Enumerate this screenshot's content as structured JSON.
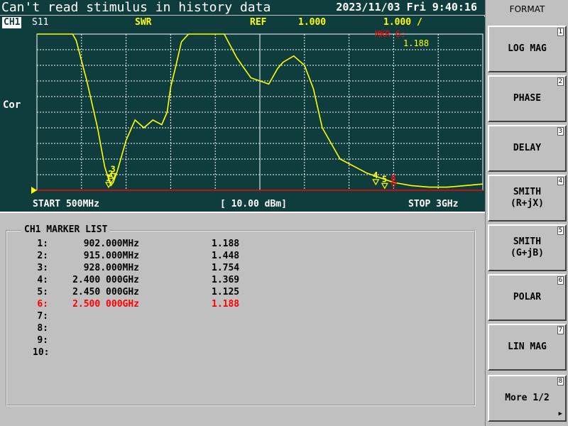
{
  "status": {
    "message": "Can't read stimulus in history data",
    "datetime": "2023/11/03 Fri   9:40:16"
  },
  "trace_header": {
    "channel": "CH1",
    "param": "S11",
    "format": "SWR",
    "ref_label": "REF",
    "ref_value": "1.000",
    "scale": "1.000 /",
    "marker_readout_label": "MKR 6:",
    "marker_readout_value": "1.188"
  },
  "side_label": "Cor",
  "colors": {
    "background": "#0f3d3d",
    "trace": "#ffff00",
    "grid": "#ffffff",
    "ref_line": "#ff0000",
    "active_marker": "#ff0000",
    "panel": "#c0c0c0"
  },
  "stimulus": {
    "start": "START 500MHz",
    "power": "[ 10.00 dBm]",
    "stop": "STOP 3GHz"
  },
  "chart_data": {
    "type": "line",
    "xlabel": "",
    "ylabel": "",
    "xlim": [
      0.5,
      3.0
    ],
    "ylim": [
      1.0,
      11.0
    ],
    "grid": true,
    "x": [
      0.5,
      0.7,
      0.72,
      0.78,
      0.84,
      0.88,
      0.9,
      0.915,
      0.928,
      0.95,
      1.0,
      1.05,
      1.08,
      1.1,
      1.15,
      1.2,
      1.23,
      1.25,
      1.28,
      1.31,
      1.35,
      1.4,
      1.45,
      1.55,
      1.62,
      1.65,
      1.7,
      1.8,
      1.85,
      1.88,
      1.94,
      2.0,
      2.05,
      2.1,
      2.2,
      2.3,
      2.35,
      2.4,
      2.45,
      2.5,
      2.6,
      2.7,
      2.8,
      2.9,
      3.0
    ],
    "series": [
      {
        "values": [
          11.0,
          11.0,
          10.6,
          8.0,
          5.0,
          2.5,
          1.8,
          1.3,
          1.5,
          2.2,
          4.2,
          5.5,
          5.2,
          5.0,
          5.5,
          5.2,
          6.0,
          7.6,
          9.0,
          10.5,
          11.0,
          11.0,
          11.0,
          11.0,
          9.5,
          9.0,
          8.2,
          7.8,
          8.8,
          9.2,
          9.6,
          9.0,
          7.5,
          5.0,
          3.0,
          2.4,
          2.1,
          1.9,
          1.7,
          1.5,
          1.3,
          1.2,
          1.2,
          1.3,
          1.4
        ]
      }
    ],
    "markers": [
      {
        "index": "1",
        "x": 0.902,
        "y": 1.188
      },
      {
        "index": "2",
        "x": 0.915,
        "y": 1.448
      },
      {
        "index": "3",
        "x": 0.928,
        "y": 1.754
      },
      {
        "index": "4",
        "x": 2.4,
        "y": 1.369
      },
      {
        "index": "5",
        "x": 2.45,
        "y": 1.125
      },
      {
        "index": "6",
        "x": 2.5,
        "y": 1.188,
        "active": true
      }
    ],
    "reference_y": 1.0
  },
  "marker_list": {
    "title": "CH1 MARKER LIST",
    "rows": [
      {
        "idx": "1:",
        "freq": "902.000MHz",
        "val": "1.188"
      },
      {
        "idx": "2:",
        "freq": "915.000MHz",
        "val": "1.448"
      },
      {
        "idx": "3:",
        "freq": "928.000MHz",
        "val": "1.754"
      },
      {
        "idx": "4:",
        "freq": "2.400 000GHz",
        "val": "1.369"
      },
      {
        "idx": "5:",
        "freq": "2.450 000GHz",
        "val": "1.125"
      },
      {
        "idx": "6:",
        "freq": "2.500 000GHz",
        "val": "1.188",
        "active": true
      },
      {
        "idx": "7:",
        "freq": "",
        "val": ""
      },
      {
        "idx": "8:",
        "freq": "",
        "val": ""
      },
      {
        "idx": "9:",
        "freq": "",
        "val": ""
      },
      {
        "idx": "10:",
        "freq": "",
        "val": ""
      }
    ]
  },
  "softkeys": {
    "title": "FORMAT",
    "items": [
      {
        "num": "1",
        "label": "LOG MAG"
      },
      {
        "num": "2",
        "label": "PHASE"
      },
      {
        "num": "3",
        "label": "DELAY"
      },
      {
        "num": "4",
        "label": "SMITH\n(R+jX)"
      },
      {
        "num": "5",
        "label": "SMITH\n(G+jB)"
      },
      {
        "num": "6",
        "label": "POLAR"
      },
      {
        "num": "7",
        "label": "LIN MAG"
      },
      {
        "num": "8",
        "label": "More 1/2",
        "arrow": "▶"
      }
    ]
  }
}
